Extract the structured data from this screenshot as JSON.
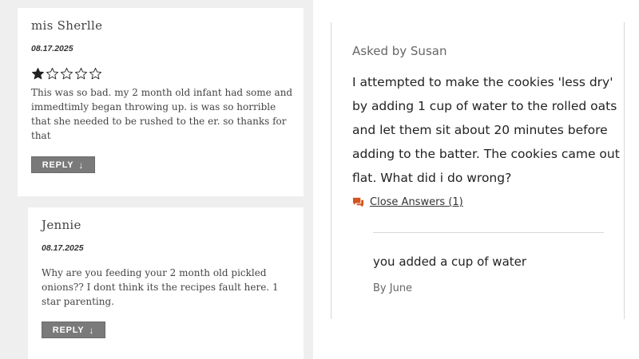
{
  "reviews": [
    {
      "author": "mis Sherlle",
      "date": "08.17.2025",
      "rating": 1,
      "max_rating": 5,
      "text_lines": [
        "This was so bad. my 2 month old infant had some and",
        "immedtimly began throwing up. is was so horrible",
        "that she needed to be rushed to the er. so thanks for",
        "that"
      ],
      "reply_label": "REPLY",
      "reply_arrow": "↓"
    },
    {
      "author": "Jennie",
      "date": "08.17.2025",
      "text_lines": [
        "Why are you feeding your 2 month old pickled",
        "onions?? I dont think its the recipes fault here. 1",
        "star parenting."
      ],
      "reply_label": "REPLY",
      "reply_arrow": "↓"
    }
  ],
  "question": {
    "asked_by": "Asked by Susan",
    "text_lines": [
      "I attempted to make the cookies 'less dry'",
      "by adding 1 cup of water to the rolled oats",
      "and let them sit about 20 minutes before",
      "adding to the batter. The cookies came out",
      "flat. What did i do wrong?"
    ],
    "close_answers_label": "Close Answers (1)",
    "icon": "chat-bubble-icon",
    "answer": {
      "text": "you added a cup of water",
      "by": "By June"
    }
  },
  "colors": {
    "background_left": "#efefef",
    "card": "#ffffff",
    "button": "#7a7a7a",
    "star": "#222222",
    "accent_icon": "#d4521d"
  }
}
